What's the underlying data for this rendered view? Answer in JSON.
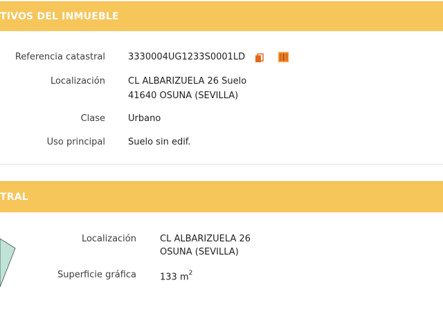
{
  "section1": {
    "title": "TIVOS DEL INMUEBLE",
    "fields": {
      "ref_label": "Referencia catastral",
      "ref_value": "3330004UG1233S0001LD",
      "loc_label": "Localización",
      "loc_line1": "CL ALBARIZUELA 26 Suelo",
      "loc_line2": "41640 OSUNA (SEVILLA)",
      "clase_label": "Clase",
      "clase_value": "Urbano",
      "uso_label": "Uso principal",
      "uso_value": "Suelo sin edif."
    },
    "icons": [
      "copy-icon",
      "barcode-icon"
    ]
  },
  "section2": {
    "title": "TRAL",
    "fields": {
      "loc_label": "Localización",
      "loc_line1": "CL ALBARIZUELA 26",
      "loc_line2": "OSUNA (SEVILLA)",
      "sup_label": "Superficie gráfica",
      "sup_value": "133 m",
      "sup_unit_exp": "2"
    }
  },
  "colors": {
    "band": "#f7c65a",
    "band_text": "#ffffff",
    "icon_orange": "#e06a1a",
    "parcel_fill": "#bfe3d6"
  }
}
